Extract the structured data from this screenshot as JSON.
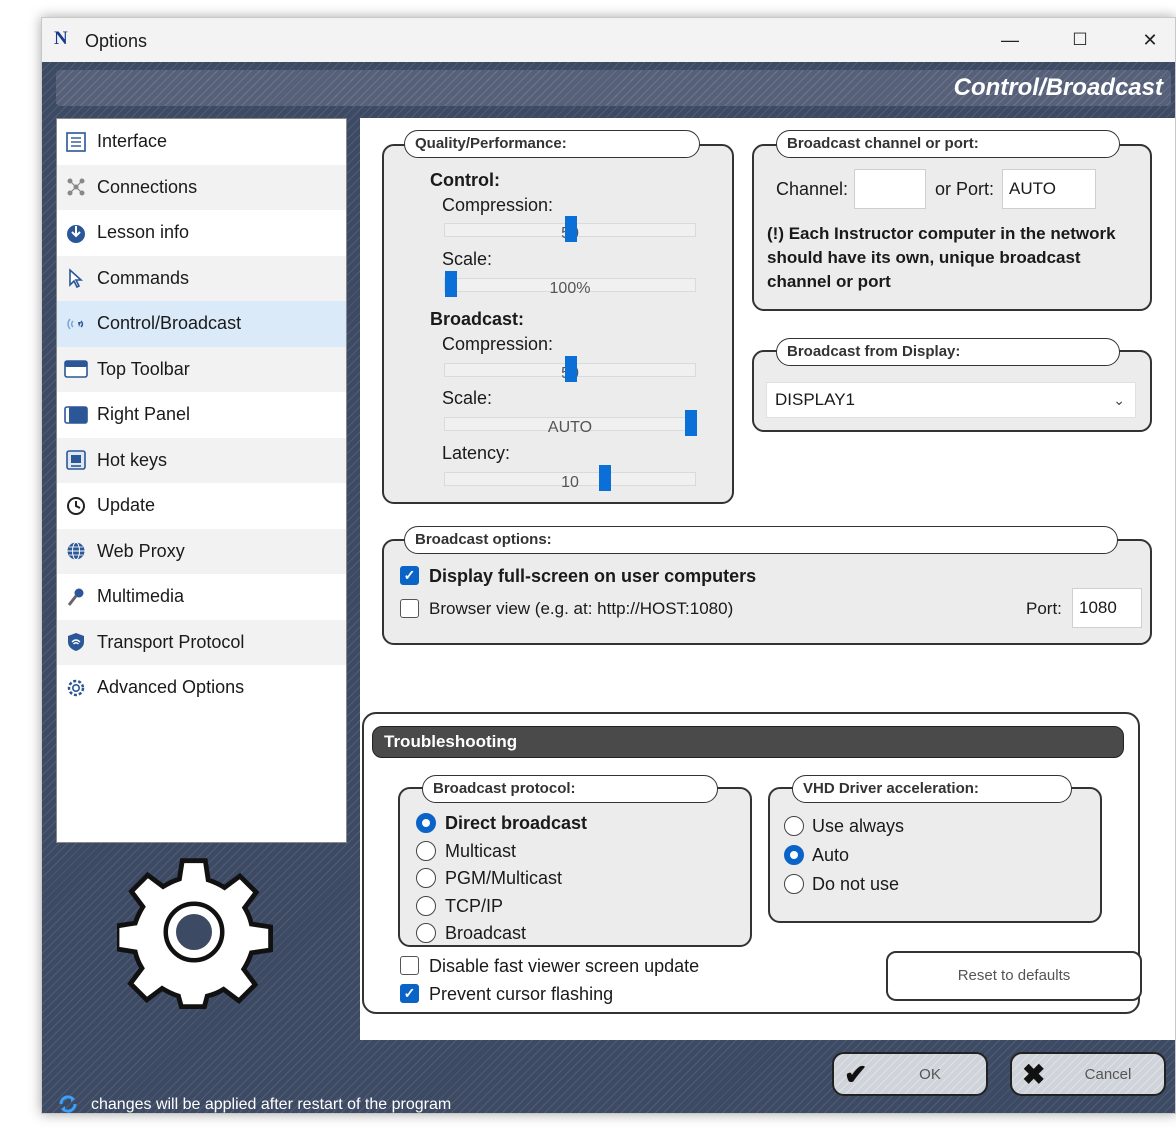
{
  "window": {
    "title": "Options",
    "minimize": "—",
    "maximize": "☐",
    "close": "✕"
  },
  "header": {
    "title": "Control/Broadcast"
  },
  "sidebar": {
    "items": [
      {
        "label": "Interface",
        "icon": "interface-icon"
      },
      {
        "label": "Connections",
        "icon": "connections-icon"
      },
      {
        "label": "Lesson info",
        "icon": "lesson-info-icon"
      },
      {
        "label": "Commands",
        "icon": "cursor-icon"
      },
      {
        "label": "Control/Broadcast",
        "icon": "broadcast-icon",
        "selected": true
      },
      {
        "label": "Top Toolbar",
        "icon": "top-toolbar-icon"
      },
      {
        "label": "Right Panel",
        "icon": "right-panel-icon"
      },
      {
        "label": "Hot keys",
        "icon": "hotkeys-icon"
      },
      {
        "label": "Update",
        "icon": "update-icon"
      },
      {
        "label": "Web Proxy",
        "icon": "globe-icon"
      },
      {
        "label": "Multimedia",
        "icon": "microphone-icon"
      },
      {
        "label": "Transport Protocol",
        "icon": "shield-icon"
      },
      {
        "label": "Advanced Options",
        "icon": "gear-icon"
      }
    ]
  },
  "quality": {
    "label": "Quality/Performance:",
    "control_heading": "Control:",
    "control_compression_label": "Compression:",
    "control_compression_value": "50",
    "control_compression_level": 0.5,
    "control_scale_label": "Scale:",
    "control_scale_value": "100%",
    "control_scale_level": 0.0,
    "broadcast_heading": "Broadcast:",
    "broadcast_compression_label": "Compression:",
    "broadcast_compression_value": "50",
    "broadcast_compression_level": 0.5,
    "broadcast_scale_label": "Scale:",
    "broadcast_scale_value": "AUTO",
    "broadcast_scale_level": 1.0,
    "latency_label": "Latency:",
    "latency_value": "10",
    "latency_level": 0.62
  },
  "channel": {
    "label": "Broadcast channel or port:",
    "channel_label": "Channel:",
    "channel_value": "",
    "port_label": "or Port:",
    "port_value": "AUTO",
    "note": "(!) Each Instructor computer in the network should have its own, unique broadcast channel or port"
  },
  "display": {
    "label": "Broadcast from Display:",
    "selected": "DISPLAY1"
  },
  "broadcast_options": {
    "label": "Broadcast options:",
    "fullscreen_label": "Display full-screen on user computers",
    "fullscreen_checked": true,
    "browser_label": "Browser view (e.g. at: http://HOST:1080)",
    "browser_checked": false,
    "port_label": "Port:",
    "port_value": "1080"
  },
  "troubleshooting": {
    "title": "Troubleshooting",
    "protocol_label": "Broadcast protocol:",
    "protocols": [
      "Direct broadcast",
      "Multicast",
      "PGM/Multicast",
      "TCP/IP",
      "Broadcast"
    ],
    "protocol_selected": 0,
    "vhd_label": "VHD Driver acceleration:",
    "vhd_options": [
      "Use always",
      "Auto",
      "Do not use"
    ],
    "vhd_selected": 1,
    "disable_fast_label": "Disable fast viewer screen update",
    "disable_fast_checked": false,
    "prevent_cursor_label": "Prevent cursor flashing",
    "prevent_cursor_checked": true,
    "reset_label": "Reset to defaults"
  },
  "footer": {
    "note": "changes will be applied after restart of the program",
    "ok_label": "OK",
    "cancel_label": "Cancel"
  }
}
